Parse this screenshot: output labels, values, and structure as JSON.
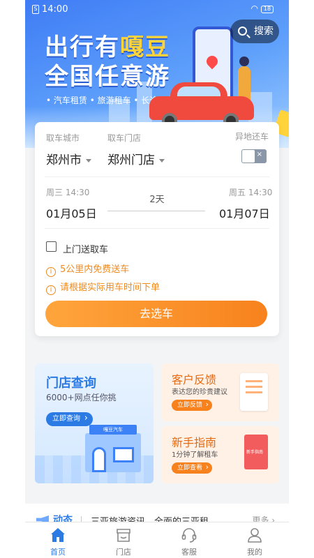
{
  "status_bar": {
    "time": "14:00",
    "sim": "S",
    "battery": "18"
  },
  "banner": {
    "title_part1": "出行有",
    "title_highlight": "嘎豆",
    "title_line2": "全国任意游",
    "tagline": "• 汽车租赁 • 旅游租车 • 长途租车",
    "search_label": "搜索"
  },
  "booking": {
    "city_label": "取车城市",
    "city_value": "郑州市",
    "store_label": "取车门店",
    "store_value": "郑州门店",
    "return_label": "异地还车",
    "toggle_x": "×",
    "start_weekday_time": "周三 14:30",
    "start_date": "01月05日",
    "duration": "2天",
    "end_weekday_time": "周五 14:30",
    "end_date": "01月07日",
    "delivery_checkbox_label": "上门送取车",
    "notice1": "5公里内免费送车",
    "notice2": "请根据实际用车时间下单",
    "notice_icon_glyph": "i",
    "cta_label": "去选车"
  },
  "tiles": {
    "store": {
      "title": "门店查询",
      "subtitle": "6000+网点任你挑",
      "button": "立即查询",
      "sign": "嘎豆汽车"
    },
    "feedback": {
      "title": "客户反馈",
      "subtitle": "表达您的珍贵建议",
      "button": "立即反馈"
    },
    "guide": {
      "title": "新手指南",
      "subtitle": "1分钟了解租车",
      "button": "立即查看"
    }
  },
  "news": {
    "label": "动态",
    "text": "三亚旅游资讯，全面的三亚租",
    "more": "更多 ›"
  },
  "tabbar": {
    "items": [
      {
        "label": "首页",
        "icon": "home-icon",
        "active": true
      },
      {
        "label": "门店",
        "icon": "store-icon",
        "active": false
      },
      {
        "label": "客服",
        "icon": "headset-icon",
        "active": false
      },
      {
        "label": "我的",
        "icon": "user-icon",
        "active": false
      }
    ]
  },
  "colors": {
    "primary_blue": "#2c7be5",
    "accent_orange": "#f7821d",
    "banner_blue": "#3f7cf5"
  }
}
